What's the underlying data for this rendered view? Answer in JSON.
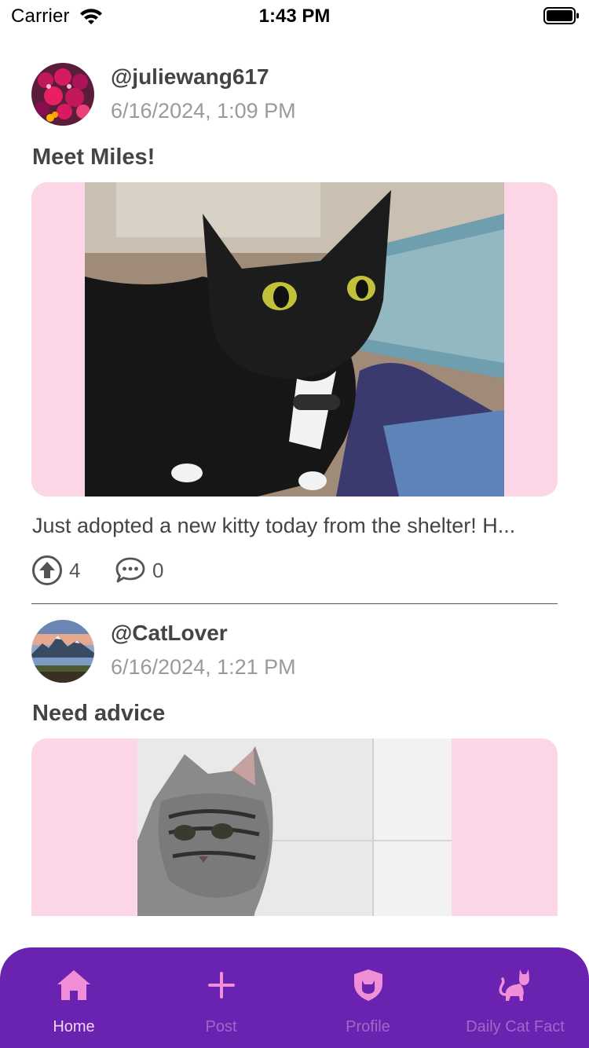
{
  "status_bar": {
    "carrier": "Carrier",
    "time": "1:43 PM"
  },
  "posts": [
    {
      "username": "@juliewang617",
      "timestamp": "6/16/2024, 1:09 PM",
      "title": "Meet Miles!",
      "caption": "Just adopted a new kitty today from the shelter! H...",
      "upvotes": "4",
      "comments": "0"
    },
    {
      "username": "@CatLover",
      "timestamp": "6/16/2024, 1:21 PM",
      "title": "Need advice"
    }
  ],
  "tabs": [
    {
      "label": "Home",
      "icon": "home-icon",
      "active": true
    },
    {
      "label": "Post",
      "icon": "plus-icon",
      "active": false
    },
    {
      "label": "Profile",
      "icon": "shield-cat-icon",
      "active": false
    },
    {
      "label": "Daily Cat Fact",
      "icon": "cat-icon",
      "active": false
    }
  ],
  "colors": {
    "accent": "#6a22b0",
    "media_background": "#fcd5e6",
    "tab_inactive": "#a466c6",
    "tab_active": "#f2d4f6"
  }
}
